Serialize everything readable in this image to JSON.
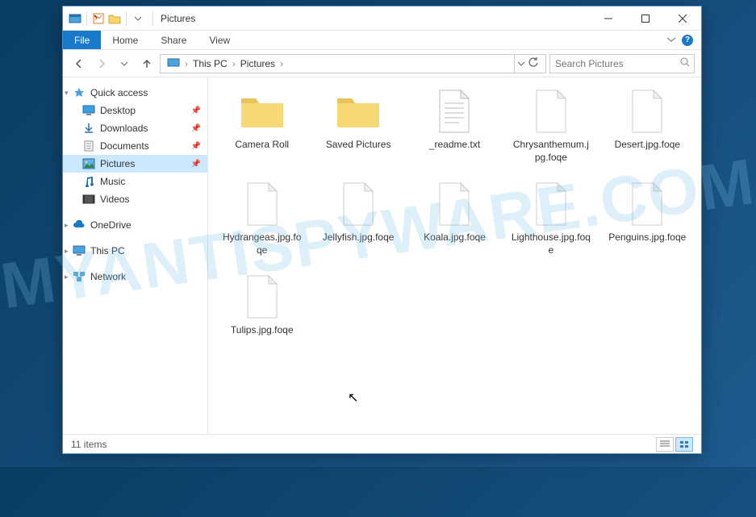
{
  "titlebar": {
    "title": "Pictures"
  },
  "ribbon": {
    "file": "File",
    "tabs": [
      "Home",
      "Share",
      "View"
    ]
  },
  "breadcrumb": {
    "items": [
      "This PC",
      "Pictures"
    ]
  },
  "search": {
    "placeholder": "Search Pictures"
  },
  "sidebar": {
    "quickaccess": {
      "label": "Quick access",
      "items": [
        {
          "label": "Desktop",
          "icon": "desktop",
          "pinned": true
        },
        {
          "label": "Downloads",
          "icon": "downloads",
          "pinned": true
        },
        {
          "label": "Documents",
          "icon": "documents",
          "pinned": true
        },
        {
          "label": "Pictures",
          "icon": "pictures",
          "pinned": true,
          "selected": true
        },
        {
          "label": "Music",
          "icon": "music"
        },
        {
          "label": "Videos",
          "icon": "videos"
        }
      ]
    },
    "onedrive": {
      "label": "OneDrive"
    },
    "thispc": {
      "label": "This PC"
    },
    "network": {
      "label": "Network"
    }
  },
  "items": [
    {
      "label": "Camera Roll",
      "type": "folder"
    },
    {
      "label": "Saved Pictures",
      "type": "folder"
    },
    {
      "label": "_readme.txt",
      "type": "txt"
    },
    {
      "label": "Chrysanthemum.jpg.foqe",
      "type": "file"
    },
    {
      "label": "Desert.jpg.foqe",
      "type": "file"
    },
    {
      "label": "Hydrangeas.jpg.foqe",
      "type": "file"
    },
    {
      "label": "Jellyfish.jpg.foqe",
      "type": "file"
    },
    {
      "label": "Koala.jpg.foqe",
      "type": "file"
    },
    {
      "label": "Lighthouse.jpg.foqe",
      "type": "file"
    },
    {
      "label": "Penguins.jpg.foqe",
      "type": "file"
    },
    {
      "label": "Tulips.jpg.foqe",
      "type": "file"
    }
  ],
  "statusbar": {
    "count_label": "11 items"
  },
  "watermark": "MYANTISPYWARE.COM"
}
